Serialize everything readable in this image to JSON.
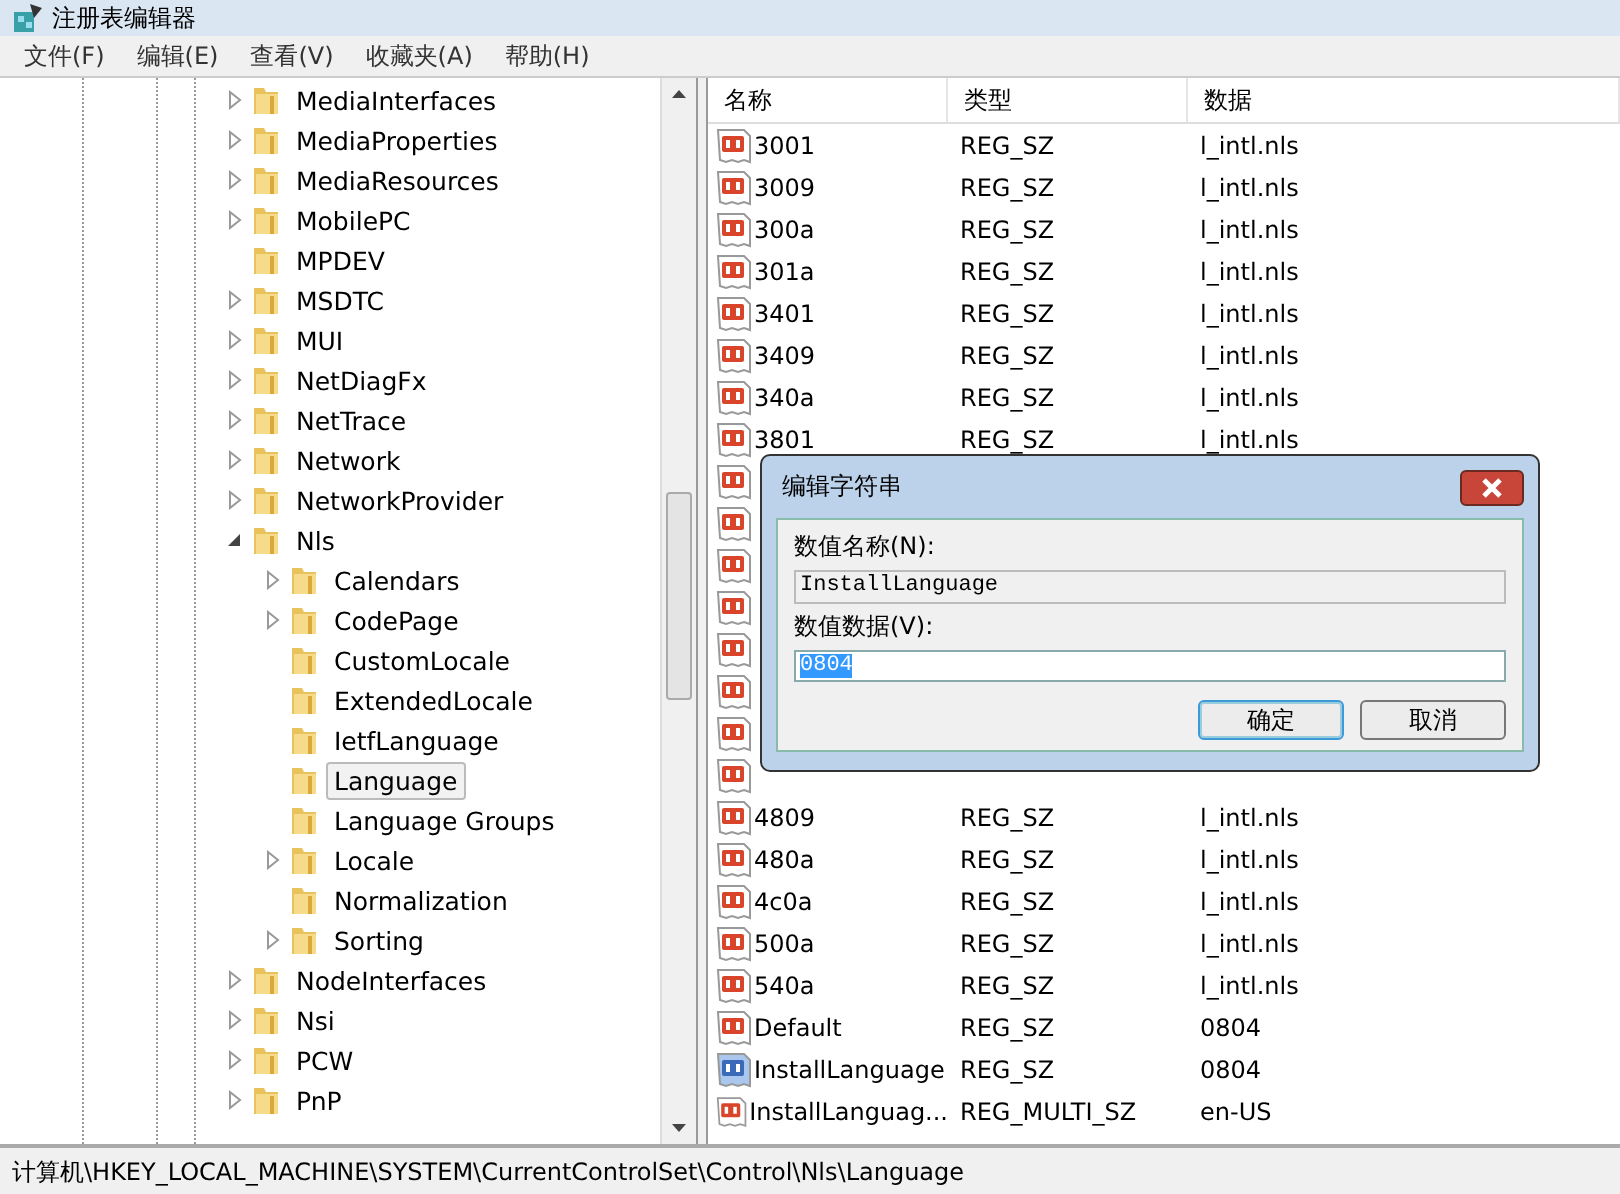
{
  "window": {
    "title": "注册表编辑器"
  },
  "menu": [
    "文件(F)",
    "编辑(E)",
    "查看(V)",
    "收藏夹(A)",
    "帮助(H)"
  ],
  "tree": [
    {
      "name": "MediaInterfaces",
      "expanded": false,
      "selected": false
    },
    {
      "name": "MediaProperties",
      "expanded": false,
      "selected": false
    },
    {
      "name": "MediaResources",
      "expanded": false,
      "selected": false
    },
    {
      "name": "MobilePC",
      "expanded": false,
      "selected": false
    },
    {
      "name": "MPDEV",
      "selected": false
    },
    {
      "name": "MSDTC",
      "expanded": false,
      "selected": false
    },
    {
      "name": "MUI",
      "expanded": false,
      "selected": false
    },
    {
      "name": "NetDiagFx",
      "expanded": false,
      "selected": false
    },
    {
      "name": "NetTrace",
      "expanded": false,
      "selected": false
    },
    {
      "name": "Network",
      "expanded": false,
      "selected": false
    },
    {
      "name": "NetworkProvider",
      "expanded": false,
      "selected": false
    },
    {
      "name": "Nls",
      "expanded": true,
      "selected": false,
      "children": [
        {
          "name": "Calendars",
          "expanded": false,
          "selected": false
        },
        {
          "name": "CodePage",
          "expanded": false,
          "selected": false
        },
        {
          "name": "CustomLocale",
          "selected": false
        },
        {
          "name": "ExtendedLocale",
          "selected": false
        },
        {
          "name": "IetfLanguage",
          "selected": false
        },
        {
          "name": "Language",
          "selected": true
        },
        {
          "name": "Language Groups",
          "selected": false
        },
        {
          "name": "Locale",
          "expanded": false,
          "selected": false
        },
        {
          "name": "Normalization",
          "selected": false
        },
        {
          "name": "Sorting",
          "expanded": false,
          "selected": false
        }
      ]
    },
    {
      "name": "NodeInterfaces",
      "expanded": false,
      "selected": false
    },
    {
      "name": "Nsi",
      "expanded": false,
      "selected": false
    },
    {
      "name": "PCW",
      "expanded": false,
      "selected": false
    },
    {
      "name": "PnP",
      "expanded": false,
      "selected": false
    }
  ],
  "table": {
    "columns": [
      "名称",
      "类型",
      "数据"
    ],
    "rows": [
      {
        "kind": "value",
        "name": "3001",
        "type": "REG_SZ",
        "data": "l_intl.nls",
        "selected": false
      },
      {
        "kind": "value",
        "name": "3009",
        "type": "REG_SZ",
        "data": "l_intl.nls",
        "selected": false
      },
      {
        "kind": "value",
        "name": "300a",
        "type": "REG_SZ",
        "data": "l_intl.nls",
        "selected": false
      },
      {
        "kind": "value",
        "name": "301a",
        "type": "REG_SZ",
        "data": "l_intl.nls",
        "selected": false
      },
      {
        "kind": "value",
        "name": "3401",
        "type": "REG_SZ",
        "data": "l_intl.nls",
        "selected": false
      },
      {
        "kind": "value",
        "name": "3409",
        "type": "REG_SZ",
        "data": "l_intl.nls",
        "selected": false
      },
      {
        "kind": "value",
        "name": "340a",
        "type": "REG_SZ",
        "data": "l_intl.nls",
        "selected": false
      },
      {
        "kind": "value",
        "name": "3801",
        "type": "REG_SZ",
        "data": "l_intl.nls",
        "selected": false
      },
      {
        "kind": "covered"
      },
      {
        "kind": "covered"
      },
      {
        "kind": "covered"
      },
      {
        "kind": "covered"
      },
      {
        "kind": "covered"
      },
      {
        "kind": "covered"
      },
      {
        "kind": "covered"
      },
      {
        "kind": "covered"
      },
      {
        "kind": "value",
        "name": "4809",
        "type": "REG_SZ",
        "data": "l_intl.nls",
        "selected": false
      },
      {
        "kind": "value",
        "name": "480a",
        "type": "REG_SZ",
        "data": "l_intl.nls",
        "selected": false
      },
      {
        "kind": "value",
        "name": "4c0a",
        "type": "REG_SZ",
        "data": "l_intl.nls",
        "selected": false
      },
      {
        "kind": "value",
        "name": "500a",
        "type": "REG_SZ",
        "data": "l_intl.nls",
        "selected": false
      },
      {
        "kind": "value",
        "name": "540a",
        "type": "REG_SZ",
        "data": "l_intl.nls",
        "selected": false
      },
      {
        "kind": "value",
        "name": "Default",
        "type": "REG_SZ",
        "data": "0804",
        "selected": false
      },
      {
        "kind": "value",
        "name": "InstallLanguage",
        "type": "REG_SZ",
        "data": "0804",
        "selected": true
      },
      {
        "kind": "value",
        "name": "InstallLanguag...",
        "type": "REG_MULTI_SZ",
        "data": "en-US",
        "selected": false
      }
    ]
  },
  "dialog": {
    "title": "编辑字符串",
    "name_label": "数值名称(N):",
    "name_value": "InstallLanguage",
    "data_label": "数值数据(V):",
    "data_value": "0804",
    "buttons": [
      {
        "label": "确定",
        "default": true
      },
      {
        "label": "取消",
        "default": false
      }
    ]
  },
  "status_bar": "计算机\\HKEY_LOCAL_MACHINE\\SYSTEM\\CurrentControlSet\\Control\\Nls\\Language"
}
